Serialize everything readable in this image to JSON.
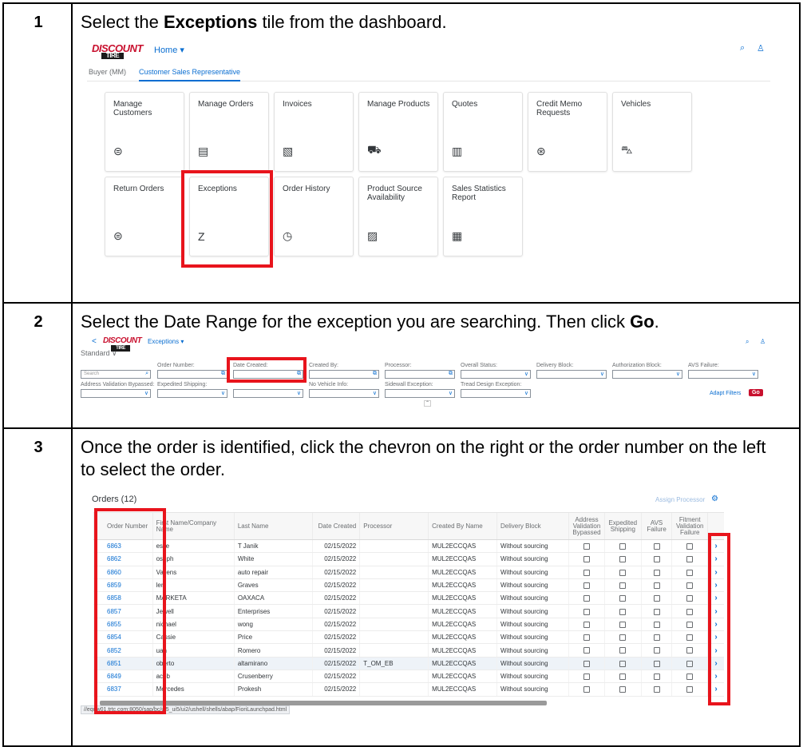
{
  "steps": [
    {
      "number": "1",
      "text_before": "Select the ",
      "bold": "Exceptions",
      "text_after": " tile from the dashboard."
    },
    {
      "number": "2",
      "text_before": "Select the Date Range for the exception you are searching. Then click ",
      "bold": "Go",
      "text_after": "."
    },
    {
      "number": "3",
      "text": "Once the order is identified, click the chevron on the right or the order number on the left to select the order."
    }
  ],
  "brand": {
    "line1": "DISCOUNT",
    "line2": "TIRE",
    "accent_color": "#c8102e",
    "highlight_color": "#e8141c",
    "link_color": "#0a6ed1"
  },
  "shot1": {
    "home_menu": "Home ▾",
    "search_icon": "⌕",
    "user_icon": "♙",
    "tabs": [
      "Buyer (MM)",
      "Customer Sales Representative"
    ],
    "tiles": [
      {
        "title": "Manage Customers",
        "icon": "⊜"
      },
      {
        "title": "Manage Orders",
        "icon": "▤"
      },
      {
        "title": "Invoices",
        "icon": "▧"
      },
      {
        "title": "Manage Products",
        "icon": "⛟"
      },
      {
        "title": "Quotes",
        "icon": "▥"
      },
      {
        "title": "Credit Memo Requests",
        "icon": "⊛"
      },
      {
        "title": "Vehicles",
        "icon": "⛍"
      },
      {
        "title": "Return Orders",
        "icon": "⊜"
      },
      {
        "title": "Exceptions",
        "icon": "Z"
      },
      {
        "title": "Order History",
        "icon": "◷"
      },
      {
        "title": "Product Source Availability",
        "icon": "▨"
      },
      {
        "title": "Sales Statistics Report",
        "icon": "▦"
      }
    ]
  },
  "shot2": {
    "back_icon": "<",
    "app_title": "Exceptions ▾",
    "variant": "Standard ∨",
    "search_placeholder": "Search",
    "fields_row1": [
      "Order Number:",
      "Date Created:",
      "Created By:",
      "Processor:",
      "Overall Status:",
      "Delivery Block:",
      "Authorization Block:",
      "AVS Failure:"
    ],
    "fields_row2": [
      "Address Validation Bypassed:",
      "Expedited Shipping:",
      "",
      "No Vehicle Info:",
      "Sidewall Exception:",
      "Tread Design Exception:"
    ],
    "adapt_filters": "Adapt Filters",
    "go": "Go"
  },
  "shot3": {
    "orders_title": "Orders (12)",
    "assign_processor": "Assign Processor",
    "settings_icon": "⚙",
    "columns": [
      "Order Number",
      "First Name/Company Name",
      "Last Name",
      "Date Created",
      "Processor",
      "Created By Name",
      "Delivery Block",
      "Address Validation Bypassed",
      "Expedited Shipping",
      "AVS Failure",
      "Fitment Validation Failure"
    ],
    "rows": [
      {
        "order": "6863",
        "first": "eslie",
        "last": "T Janik",
        "date": "02/15/2022",
        "processor": "",
        "created_by": "MUL2ECCQAS",
        "block": "Without sourcing"
      },
      {
        "order": "6862",
        "first": "oseph",
        "last": "White",
        "date": "02/15/2022",
        "processor": "",
        "created_by": "MUL2ECCQAS",
        "block": "Without sourcing"
      },
      {
        "order": "6860",
        "first": "Vallens",
        "last": "auto repair",
        "date": "02/15/2022",
        "processor": "",
        "created_by": "MUL2ECCQAS",
        "block": "Without sourcing"
      },
      {
        "order": "6859",
        "first": "len",
        "last": "Graves",
        "date": "02/15/2022",
        "processor": "",
        "created_by": "MUL2ECCQAS",
        "block": "Without sourcing"
      },
      {
        "order": "6858",
        "first": "MARKETA",
        "last": "OAXACA",
        "date": "02/15/2022",
        "processor": "",
        "created_by": "MUL2ECCQAS",
        "block": "Without sourcing"
      },
      {
        "order": "6857",
        "first": "Jewell",
        "last": "Enterprises",
        "date": "02/15/2022",
        "processor": "",
        "created_by": "MUL2ECCQAS",
        "block": "Without sourcing"
      },
      {
        "order": "6855",
        "first": "nichael",
        "last": "wong",
        "date": "02/15/2022",
        "processor": "",
        "created_by": "MUL2ECCQAS",
        "block": "Without sourcing"
      },
      {
        "order": "6854",
        "first": "Cassie",
        "last": "Price",
        "date": "02/15/2022",
        "processor": "",
        "created_by": "MUL2ECCQAS",
        "block": "Without sourcing"
      },
      {
        "order": "6852",
        "first": "uan",
        "last": "Romero",
        "date": "02/15/2022",
        "processor": "",
        "created_by": "MUL2ECCQAS",
        "block": "Without sourcing"
      },
      {
        "order": "6851",
        "first": "oberto",
        "last": "altamirano",
        "date": "02/15/2022",
        "processor": "T_OM_EB",
        "created_by": "MUL2ECCQAS",
        "block": "Without sourcing"
      },
      {
        "order": "6849",
        "first": "acob",
        "last": "Crusenberry",
        "date": "02/15/2022",
        "processor": "",
        "created_by": "MUL2ECCQAS",
        "block": "Without sourcing"
      },
      {
        "order": "6837",
        "first": "Mercedes",
        "last": "Prokesh",
        "date": "02/15/2022",
        "processor": "",
        "created_by": "MUL2ECCQAS",
        "block": "Without sourcing"
      }
    ],
    "status_url": "//eqqw01.trtc.com:8050/sap/bc/ui5_ui5/ui2/ushell/shells/abap/FioriLaunchpad.html"
  }
}
